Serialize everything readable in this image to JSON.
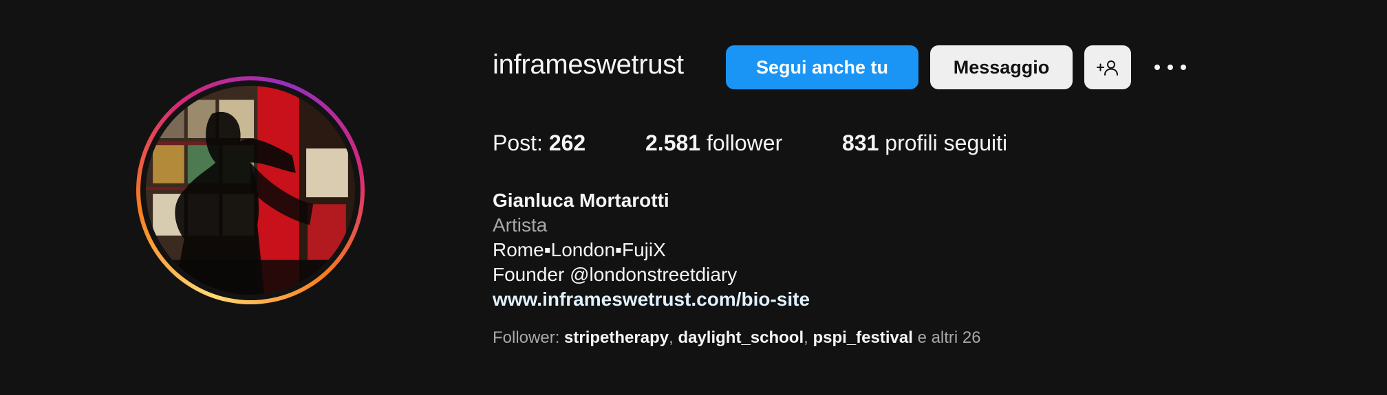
{
  "profile": {
    "username": "inframeswetrust",
    "avatar_alt": "Profile photo of inframeswetrust"
  },
  "actions": {
    "follow_label": "Segui anche tu",
    "message_label": "Messaggio",
    "add_user_icon": "add-user-icon",
    "more_icon": "more-options-icon"
  },
  "stats": {
    "posts_label": "Post:",
    "posts_count": "262",
    "followers_count": "2.581",
    "followers_label": "follower",
    "following_count": "831",
    "following_label": "profili seguiti"
  },
  "bio": {
    "full_name": "Gianluca Mortarotti",
    "category": "Artista",
    "line1": "Rome▪London▪FujiX",
    "line2": "Founder @londonstreetdiary",
    "website": "www.inframeswetrust.com/bio-site"
  },
  "followed_by": {
    "prefix": "Follower:",
    "users": [
      "stripetherapy",
      "daylight_school",
      "pspi_festival"
    ],
    "separator": ",",
    "suffix": "e altri 26"
  },
  "colors": {
    "background": "#121212",
    "follow_button": "#1a95f5",
    "secondary_button": "#efefef",
    "link": "#e0f1ff"
  }
}
